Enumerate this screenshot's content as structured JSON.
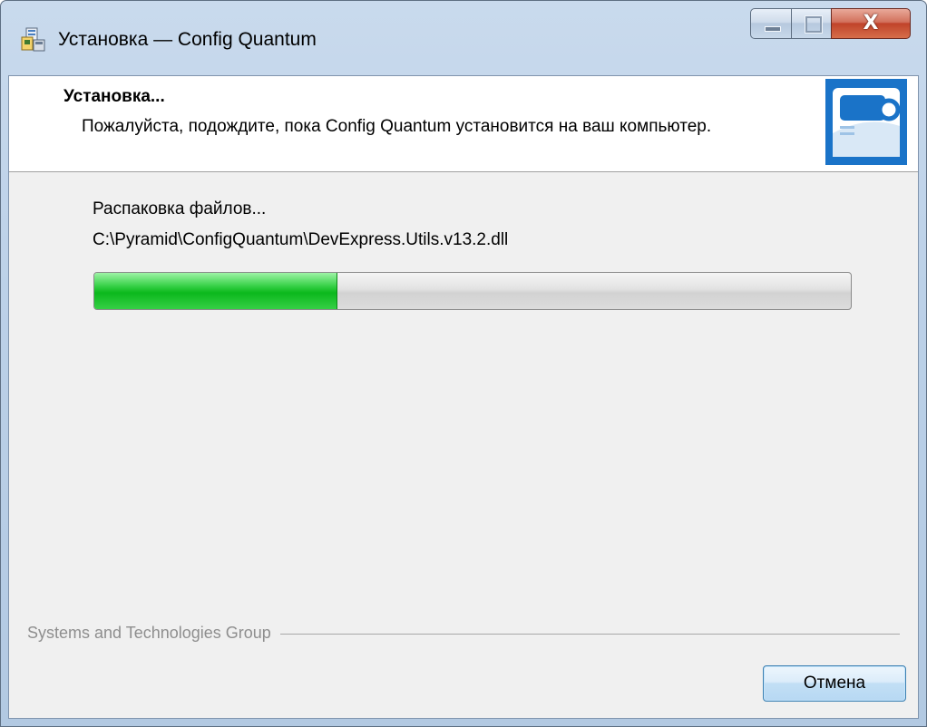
{
  "window": {
    "title": "Установка — Config Quantum",
    "close_glyph": "X"
  },
  "header": {
    "title": "Установка...",
    "subtitle": "Пожалуйста, подождите, пока Config Quantum установится на ваш компьютер."
  },
  "main": {
    "status_text": "Распаковка файлов...",
    "current_file": "C:\\Pyramid\\ConfigQuantum\\DevExpress.Utils.v13.2.dll",
    "progress_fraction": 0.32
  },
  "footer": {
    "group_label": "Systems and Technologies Group",
    "cancel_label": "Отмена"
  },
  "icons": {
    "app": "installer-icon",
    "logo": "config-quantum-logo",
    "minimize": "minimize-icon",
    "maximize": "maximize-icon",
    "close": "close-icon"
  },
  "colors": {
    "progress_green": "#0bb81c",
    "logo_blue": "#1a73c8",
    "close_red": "#c0432a"
  }
}
